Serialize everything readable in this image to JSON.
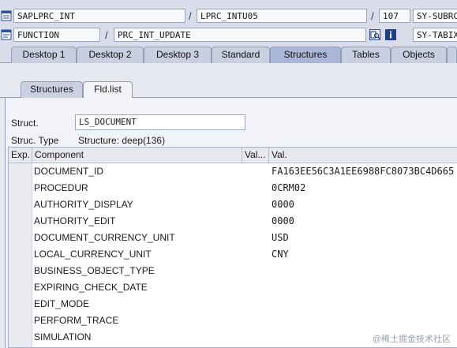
{
  "header": {
    "row1": {
      "program": "SAPLPRC_INT",
      "include": "LPRC_INTU05",
      "line": "107",
      "sysfield": "SY-SUBRC"
    },
    "row2": {
      "type": "FUNCTION",
      "name": "PRC_INT_UPDATE",
      "sysfield": "SY-TABIX"
    }
  },
  "tabs": [
    "Desktop 1",
    "Desktop 2",
    "Desktop 3",
    "Standard",
    "Structures",
    "Tables",
    "Objects"
  ],
  "subtabs": [
    "Structures",
    "Fld.list"
  ],
  "struct": {
    "struct_label": "Struct.",
    "struct_value": "LS_DOCUMENT",
    "type_label": "Struc. Type",
    "type_value": "Structure: deep(136)"
  },
  "grid": {
    "headers": {
      "exp": "Exp.",
      "component": "Component",
      "valshort": "Val...",
      "val": "Val."
    },
    "rows": [
      {
        "component": "DOCUMENT_ID",
        "val": "FA163EE56C3A1EE6988FC8073BC4D665"
      },
      {
        "component": "PROCEDUR",
        "val": "0CRM02"
      },
      {
        "component": "AUTHORITY_DISPLAY",
        "val": "0000"
      },
      {
        "component": "AUTHORITY_EDIT",
        "val": "0000"
      },
      {
        "component": "DOCUMENT_CURRENCY_UNIT",
        "val": "USD"
      },
      {
        "component": "LOCAL_CURRENCY_UNIT",
        "val": "CNY"
      },
      {
        "component": "BUSINESS_OBJECT_TYPE",
        "val": ""
      },
      {
        "component": "EXPIRING_CHECK_DATE",
        "val": ""
      },
      {
        "component": "EDIT_MODE",
        "val": ""
      },
      {
        "component": "PERFORM_TRACE",
        "val": ""
      },
      {
        "component": "SIMULATION",
        "val": ""
      }
    ]
  },
  "watermark": "@稀土掘金技术社区"
}
